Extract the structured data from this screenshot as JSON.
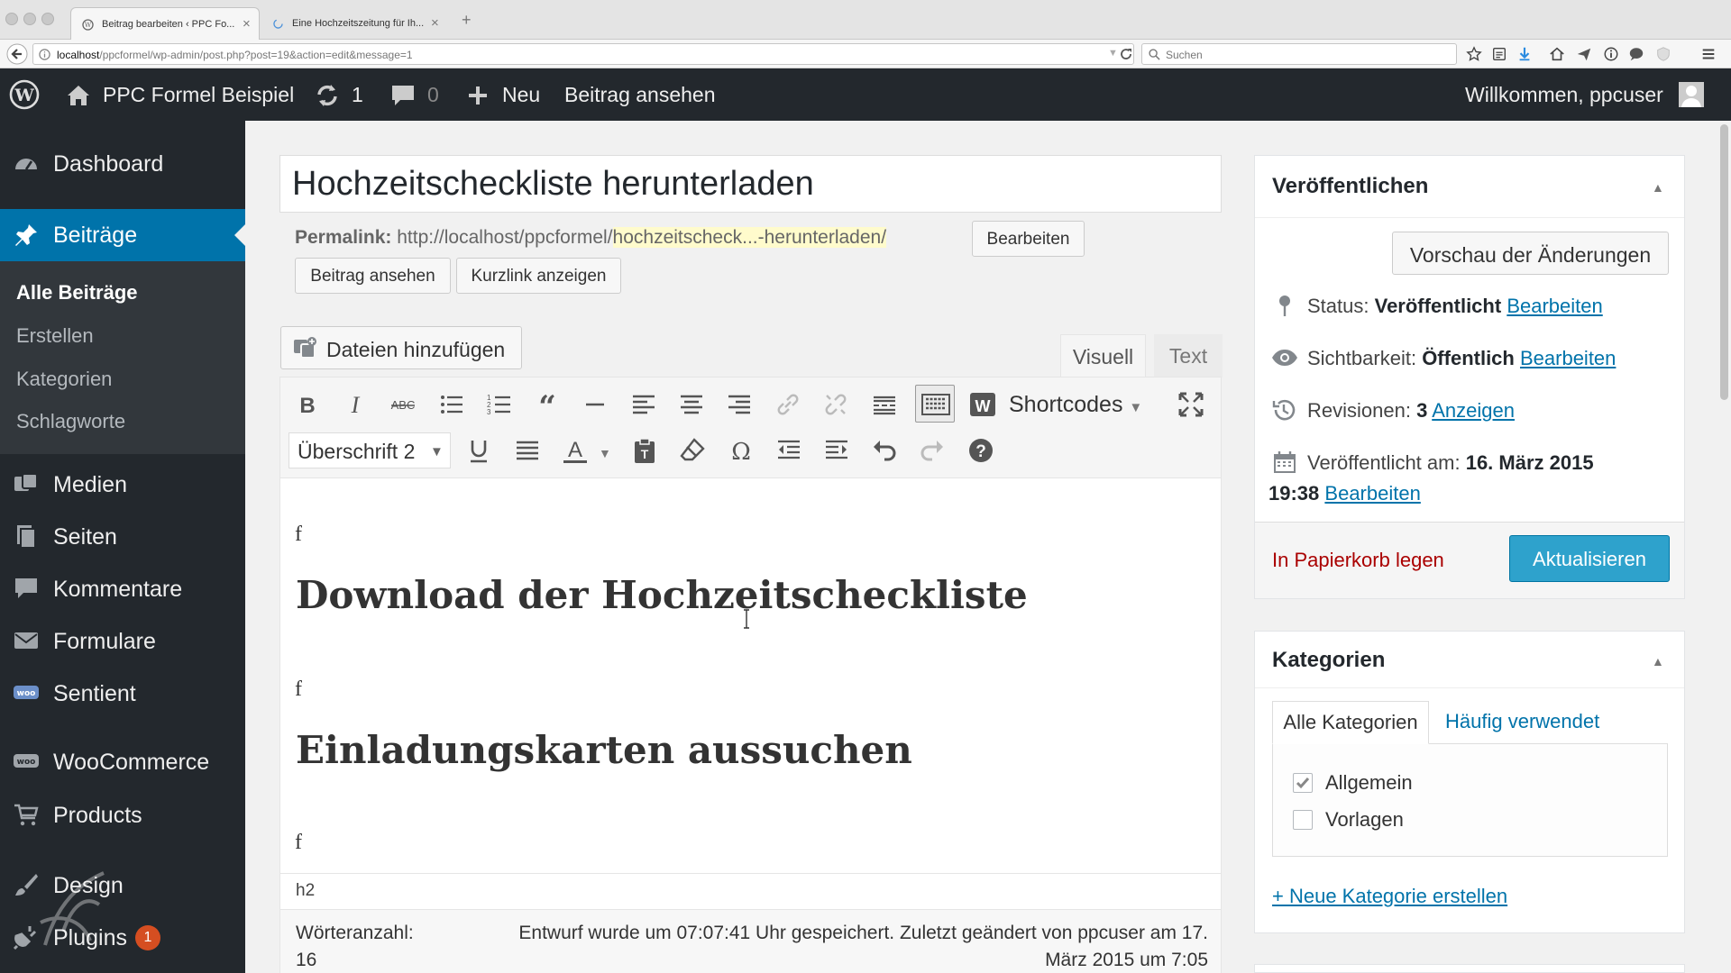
{
  "browser": {
    "tabs": [
      {
        "title": "Beitrag bearbeiten ‹ PPC Fo..."
      },
      {
        "title": "Eine Hochzeitszeitung für Ih..."
      }
    ],
    "url": {
      "host": "localhost",
      "path": "/ppcformel/wp-admin/post.php?post=19&action=edit&message=1"
    },
    "search_placeholder": "Suchen"
  },
  "adminbar": {
    "site_name": "PPC Formel Beispiel",
    "updates_count": "1",
    "comments_count": "0",
    "new_label": "Neu",
    "view_post": "Beitrag ansehen",
    "welcome": "Willkommen, ppcuser"
  },
  "sidebar": {
    "items": [
      {
        "label": "Dashboard",
        "icon": "dashboard-icon"
      },
      {
        "label": "Beiträge",
        "icon": "pin-icon"
      },
      {
        "label": "Medien",
        "icon": "media-icon"
      },
      {
        "label": "Seiten",
        "icon": "pages-icon"
      },
      {
        "label": "Kommentare",
        "icon": "comment-icon"
      },
      {
        "label": "Formulare",
        "icon": "mail-icon"
      },
      {
        "label": "Sentient",
        "icon": "woo-icon"
      },
      {
        "label": "WooCommerce",
        "icon": "woo-icon"
      },
      {
        "label": "Products",
        "icon": "cart-icon"
      },
      {
        "label": "Design",
        "icon": "brush-icon"
      },
      {
        "label": "Plugins",
        "icon": "plug-icon",
        "badge": "1"
      }
    ],
    "submenu": [
      "Alle Beiträge",
      "Erstellen",
      "Kategorien",
      "Schlagworte"
    ]
  },
  "editor": {
    "title": "Hochzeitscheckliste herunterladen",
    "permalink_label": "Permalink:",
    "permalink_base": "http://localhost/ppcformel/",
    "permalink_slug": "hochzeitscheck...-herunterladen/",
    "edit_button": "Bearbeiten",
    "view_post_button": "Beitrag ansehen",
    "shortlink_button": "Kurzlink anzeigen",
    "add_media_button": "Dateien hinzufügen",
    "tab_visual": "Visuell",
    "tab_text": "Text",
    "shortcodes_label": "Shortcodes",
    "format_select": "Überschrift 2",
    "content": {
      "p1": "f",
      "h2_1": "Download der Hochzeitscheckliste",
      "p2": "f",
      "h2_2": "Einladungskarten aussuchen",
      "p3": "f"
    },
    "path": "h2",
    "word_count_label": "Wörteranzahl:",
    "word_count": "16",
    "status_line1": "Entwurf wurde um 07:07:41 Uhr gespeichert. Zuletzt geändert von ppcuser am 17.",
    "status_line2": "März 2015 um 7:05"
  },
  "publish": {
    "heading": "Veröffentlichen",
    "preview_button": "Vorschau der Änderungen",
    "status_label": "Status:",
    "status_value": "Veröffentlicht",
    "visibility_label": "Sichtbarkeit:",
    "visibility_value": "Öffentlich",
    "revisions_label": "Revisionen:",
    "revisions_value": "3",
    "revisions_link": "Anzeigen",
    "published_label": "Veröffentlicht am:",
    "published_date": "16. März 2015",
    "published_time": "19:38",
    "edit_link": "Bearbeiten",
    "trash_link": "In Papierkorb legen",
    "update_button": "Aktualisieren"
  },
  "categories": {
    "heading": "Kategorien",
    "tab_all": "Alle Kategorien",
    "tab_popular": "Häufig verwendet",
    "items": [
      {
        "label": "Allgemein",
        "checked": true
      },
      {
        "label": "Vorlagen",
        "checked": false
      }
    ],
    "add_link": "+ Neue Kategorie erstellen"
  },
  "colors": {
    "accent": "#0073aa",
    "menu_active": "#0073aa",
    "primary_button": "#2ea2cc",
    "trash": "#a00"
  }
}
